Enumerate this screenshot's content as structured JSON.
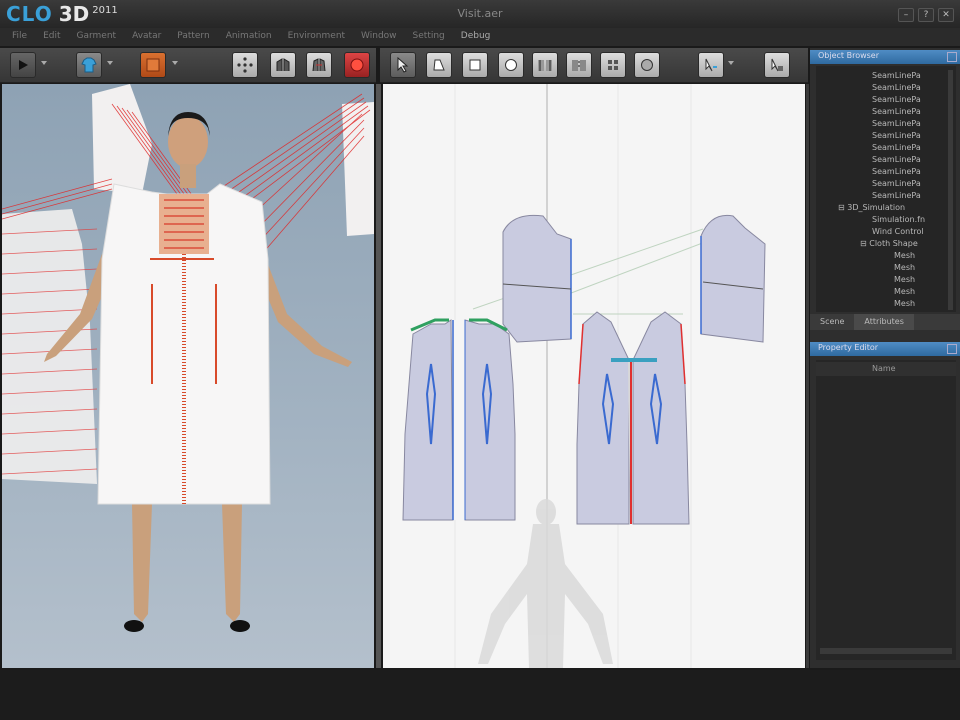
{
  "app": {
    "logo_text": "CLO",
    "logo_3d": "3D",
    "logo_year": "2011",
    "window_title": "Visit.aer",
    "accent": "#3aa0d8"
  },
  "window_controls": [
    {
      "name": "minimize-button",
      "icon": "minimize-icon",
      "glyph": "–"
    },
    {
      "name": "help-button",
      "icon": "help-icon",
      "glyph": "?"
    },
    {
      "name": "close-button",
      "icon": "close-icon",
      "glyph": "✕"
    }
  ],
  "menu": [
    "File",
    "Edit",
    "Garment",
    "Avatar",
    "Pattern",
    "Animation",
    "Environment",
    "Window",
    "Setting",
    "Debug"
  ],
  "toolbar_3d": [
    {
      "name": "simulate-button",
      "icon": "play-icon"
    },
    {
      "name": "garment-button",
      "icon": "garment-icon"
    },
    {
      "name": "texture-button",
      "icon": "texture-icon"
    },
    {
      "name": "points-button",
      "icon": "points-icon"
    },
    {
      "name": "fold-button",
      "icon": "fold-icon"
    },
    {
      "name": "tack-button",
      "icon": "tack-icon"
    },
    {
      "name": "record-button",
      "icon": "record-icon"
    }
  ],
  "toolbar_2d": [
    {
      "name": "select-button",
      "icon": "cursor-icon"
    },
    {
      "name": "polygon-button",
      "icon": "polygon-icon"
    },
    {
      "name": "rectangle-button",
      "icon": "rectangle-icon"
    },
    {
      "name": "circle-button",
      "icon": "circle-icon"
    },
    {
      "name": "segment-sewing-button",
      "icon": "seam-icon"
    },
    {
      "name": "free-sewing-button",
      "icon": "seam-free-icon"
    },
    {
      "name": "pin-button",
      "icon": "pin-icon"
    },
    {
      "name": "internal-shape-button",
      "icon": "internal-shape-icon"
    },
    {
      "name": "edit-sewing-button",
      "icon": "edit-sewing-icon"
    },
    {
      "name": "notch-button",
      "icon": "notch-icon"
    }
  ],
  "object_browser": {
    "title": "Object Browser",
    "items": [
      "SeamLinePa",
      "SeamLinePa",
      "SeamLinePa",
      "SeamLinePa",
      "SeamLinePa",
      "SeamLinePa",
      "SeamLinePa",
      "SeamLinePa",
      "SeamLinePa",
      "SeamLinePa",
      "SeamLinePa"
    ],
    "group": "3D_Simulation",
    "sub_items": [
      "Simulation.fn",
      "Wind Control",
      "Cloth Shape"
    ],
    "leaves": [
      "Mesh",
      "Mesh",
      "Mesh",
      "Mesh",
      "Mesh"
    ]
  },
  "tabs": [
    "Scene",
    "Attributes"
  ],
  "property_panel": {
    "title": "Property Editor",
    "row": "Name"
  }
}
